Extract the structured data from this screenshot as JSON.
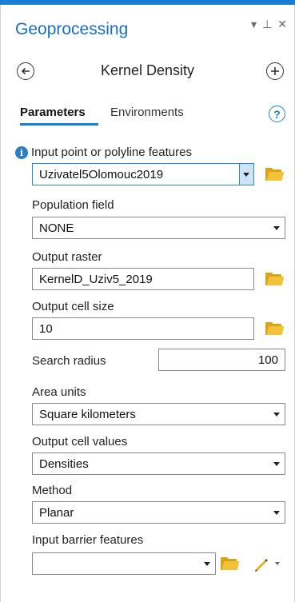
{
  "pane": {
    "title": "Geoprocessing",
    "ctrl_dropdown": "▾",
    "ctrl_pin": "⊥",
    "ctrl_close": "✕"
  },
  "tool": {
    "title": "Kernel Density"
  },
  "tabs": {
    "parameters": "Parameters",
    "environments": "Environments",
    "help": "?"
  },
  "params": {
    "input_features": {
      "label": "Input point or polyline features",
      "value": "Uzivatel5Olomouc2019"
    },
    "population_field": {
      "label": "Population field",
      "value": "NONE"
    },
    "output_raster": {
      "label": "Output raster",
      "value": "KernelD_Uziv5_2019"
    },
    "cell_size": {
      "label": "Output cell size",
      "value": "10"
    },
    "search_radius": {
      "label": "Search radius",
      "value": "100"
    },
    "area_units": {
      "label": "Area units",
      "value": "Square kilometers"
    },
    "cell_values": {
      "label": "Output cell values",
      "value": "Densities"
    },
    "method": {
      "label": "Method",
      "value": "Planar"
    },
    "barrier": {
      "label": "Input barrier features",
      "value": ""
    }
  },
  "colors": {
    "accent": "#1a7fd4",
    "folder": "#f2c23a",
    "info": "#2d7cc8"
  }
}
